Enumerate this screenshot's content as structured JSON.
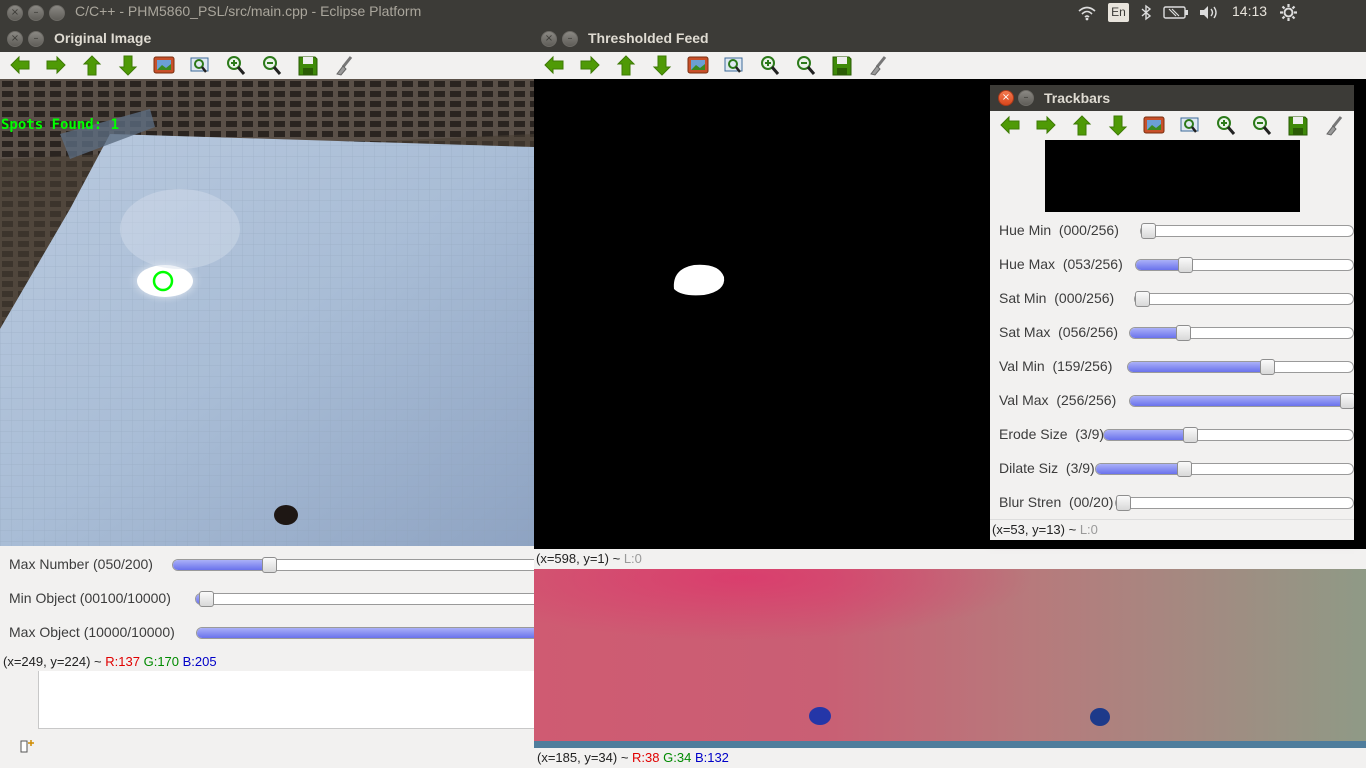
{
  "panel": {
    "window_title": "C/C++ - PHM5860_PSL/src/main.cpp - Eclipse Platform",
    "keyboard_layout": "En",
    "time": "14:13"
  },
  "toolbar_icons": [
    "arrow-left-icon",
    "arrow-right-icon",
    "arrow-up-icon",
    "arrow-down-icon",
    "image-icon",
    "zoom-fit-icon",
    "zoom-in-icon",
    "zoom-out-icon",
    "save-icon",
    "brush-icon"
  ],
  "original": {
    "title": "Original Image",
    "overlay_text": "Spots Found: 1",
    "trackbars": [
      {
        "label": "Max Number (050/200)",
        "value": 50,
        "max": 200
      },
      {
        "label": "Min Object (00100/10000)",
        "value": 100,
        "max": 10000
      },
      {
        "label": "Max Object (10000/10000)",
        "value": 10000,
        "max": 10000
      }
    ],
    "status": {
      "pos": "(x=249, y=224) ~ ",
      "r": "R:137",
      "g": "G:170",
      "b": "B:205"
    }
  },
  "thresholded": {
    "title": "Thresholded Feed",
    "status": {
      "pos": "(x=598, y=1) ~ ",
      "l": "L:0"
    }
  },
  "trackbars_win": {
    "title": "Trackbars",
    "items": [
      {
        "label": "Hue Min",
        "value_text": "(000/256)",
        "value": 0,
        "max": 256
      },
      {
        "label": "Hue Max",
        "value_text": "(053/256)",
        "value": 53,
        "max": 256
      },
      {
        "label": "Sat Min",
        "value_text": "(000/256)",
        "value": 0,
        "max": 256
      },
      {
        "label": "Sat Max",
        "value_text": "(056/256)",
        "value": 56,
        "max": 256
      },
      {
        "label": "Val Min",
        "value_text": "(159/256)",
        "value": 159,
        "max": 256
      },
      {
        "label": "Val Max",
        "value_text": "(256/256)",
        "value": 256,
        "max": 256
      },
      {
        "label": "Erode Size",
        "value_text": "(3/9)",
        "value": 3,
        "max": 9
      },
      {
        "label": "Dilate Siz",
        "value_text": "(3/9)",
        "value": 3,
        "max": 9
      },
      {
        "label": "Blur Stren",
        "value_text": "(00/20)",
        "value": 0,
        "max": 20
      }
    ],
    "status": {
      "pos": "(x=53, y=13) ~ ",
      "l": "L:0"
    }
  },
  "hsv": {
    "status": {
      "pos": "(x=185, y=34) ~ ",
      "r": "R:38",
      "g": "G:34",
      "b": "B:132"
    }
  },
  "colors": {
    "accent_green": "#00ff00",
    "slider_fill": "#6a72ec",
    "panel": "#3c3b37"
  }
}
